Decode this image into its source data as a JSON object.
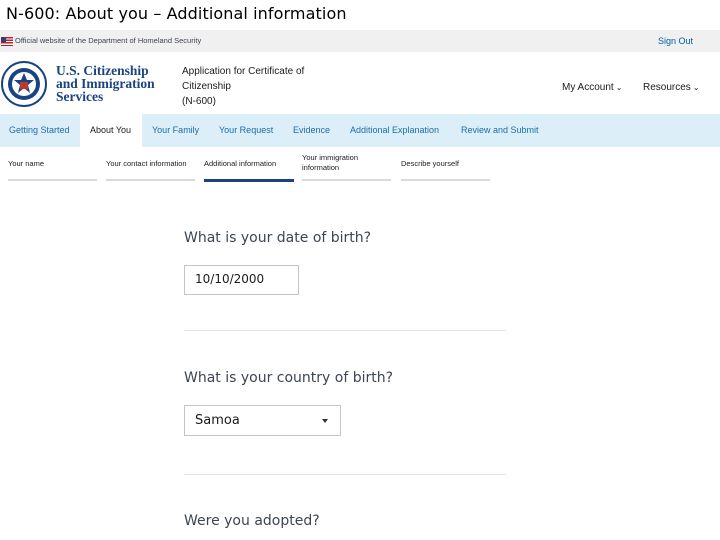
{
  "slide_title": "N-600: About you – Additional information",
  "gov_banner": {
    "text": "Official website of the Department of Homeland Security",
    "sign_out": "Sign Out"
  },
  "header": {
    "agency_lines": [
      "U.S. Citizenship",
      "and Immigration",
      "Services"
    ],
    "app_title_lines": [
      "Application for Certificate of",
      "Citizenship",
      "(N-600)"
    ],
    "my_account": "My Account",
    "resources": "Resources"
  },
  "main_nav": {
    "items": [
      "Getting Started",
      "About You",
      "Your Family",
      "Your Request",
      "Evidence",
      "Additional Explanation",
      "Review and Submit"
    ],
    "active": "About You"
  },
  "sub_nav": {
    "tabs": [
      "Your name",
      "Your contact information",
      "Additional information",
      "Your immigration information",
      "Describe yourself"
    ],
    "active": "Additional information"
  },
  "form": {
    "dob_question": "What is your date of birth?",
    "dob_value": "10/10/2000",
    "country_question": "What is your country of birth?",
    "country_value": "Samoa",
    "adopted_question": "Were you adopted?"
  },
  "colors": {
    "brand_blue": "#1a4480",
    "link_blue": "#1a6fa8",
    "nav_bg": "#dceef7"
  }
}
